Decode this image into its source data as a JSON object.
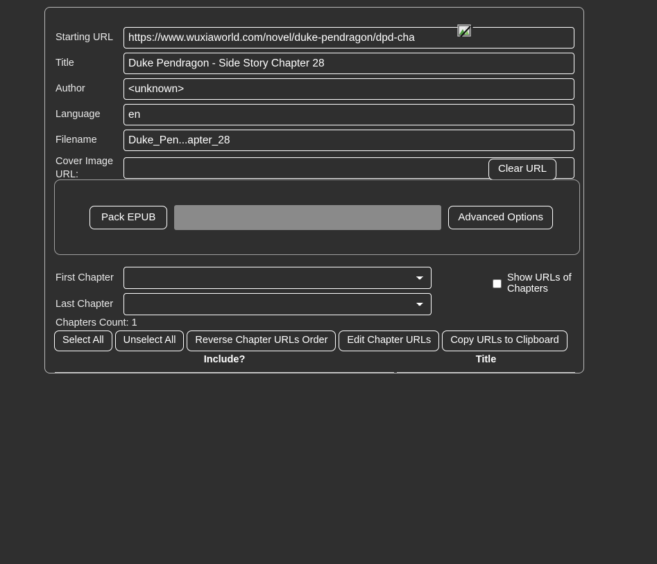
{
  "form": {
    "rows": [
      {
        "label": "Starting URL",
        "value": "https://www.wuxiaworld.com/novel/duke-pendragon/dpd-cha",
        "placeholder": ""
      },
      {
        "label": "Title",
        "value": "Duke Pendragon - Side Story Chapter 28",
        "placeholder": ""
      },
      {
        "label": "Author",
        "value": "<unknown>",
        "placeholder": ""
      },
      {
        "label": "Language",
        "value": "en",
        "placeholder": ""
      },
      {
        "label": "Filename",
        "value": "Duke_Pen...apter_28",
        "placeholder": ""
      }
    ],
    "cover_image": {
      "label_line1": "Cover Image",
      "label_line2": "URL:",
      "value": "",
      "placeholder": ""
    },
    "clear_url_label": "Clear URL",
    "cover_preview_icon": "broken-image-icon"
  },
  "pack": {
    "pack_epub_label": "Pack EPUB",
    "advanced_options_label": "Advanced Options",
    "progress_percent": 0
  },
  "chapters": {
    "first_chapter_label": "First Chapter",
    "first_chapter_value": "",
    "last_chapter_label": "Last Chapter",
    "last_chapter_value": "",
    "show_urls_label": "Show URLs of Chapters",
    "show_urls_checked": false,
    "count_text": "Chapters Count: 1",
    "actions": [
      "Select All",
      "Unselect All",
      "Reverse Chapter URLs Order",
      "Edit Chapter URLs",
      "Copy URLs to Clipboard"
    ],
    "table_headers": [
      "Include?",
      "Title"
    ]
  },
  "colors": {
    "page_background": "#2f2f2f",
    "panel_border": "#b9b9b9",
    "control_border": "#ffffff",
    "text": "#ffffff",
    "progress_track": "#8a8a8a",
    "fieldset_border": "#a0a0a0"
  }
}
